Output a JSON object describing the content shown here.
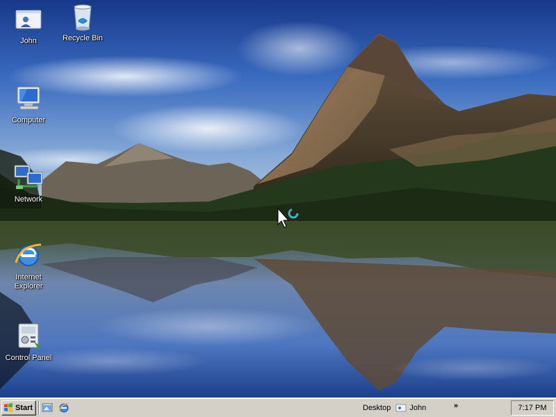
{
  "desktop": {
    "icons": [
      {
        "label": "John",
        "icon": "user-folder-icon"
      },
      {
        "label": "Recycle Bin",
        "icon": "recycle-bin-icon"
      },
      {
        "label": "Computer",
        "icon": "computer-icon"
      },
      {
        "label": "Network",
        "icon": "network-icon"
      },
      {
        "label": "Internet\nExplorer",
        "icon": "internet-explorer-icon"
      },
      {
        "label": "Control Panel",
        "icon": "control-panel-icon"
      }
    ],
    "busy_cursor": "arrow-busy-cursor-icon"
  },
  "taskbar": {
    "start_label": "Start",
    "quick_launch": [
      {
        "name": "show-desktop",
        "icon": "show-desktop-icon"
      },
      {
        "name": "internet-explorer",
        "icon": "internet-explorer-icon"
      }
    ],
    "address": {
      "desktop_label": "Desktop",
      "user_label": "John"
    },
    "overflow": "»",
    "clock": "7:17 PM"
  },
  "colors": {
    "taskbar_bg": "#d4d0c8",
    "icon_label": "#ffffff"
  }
}
